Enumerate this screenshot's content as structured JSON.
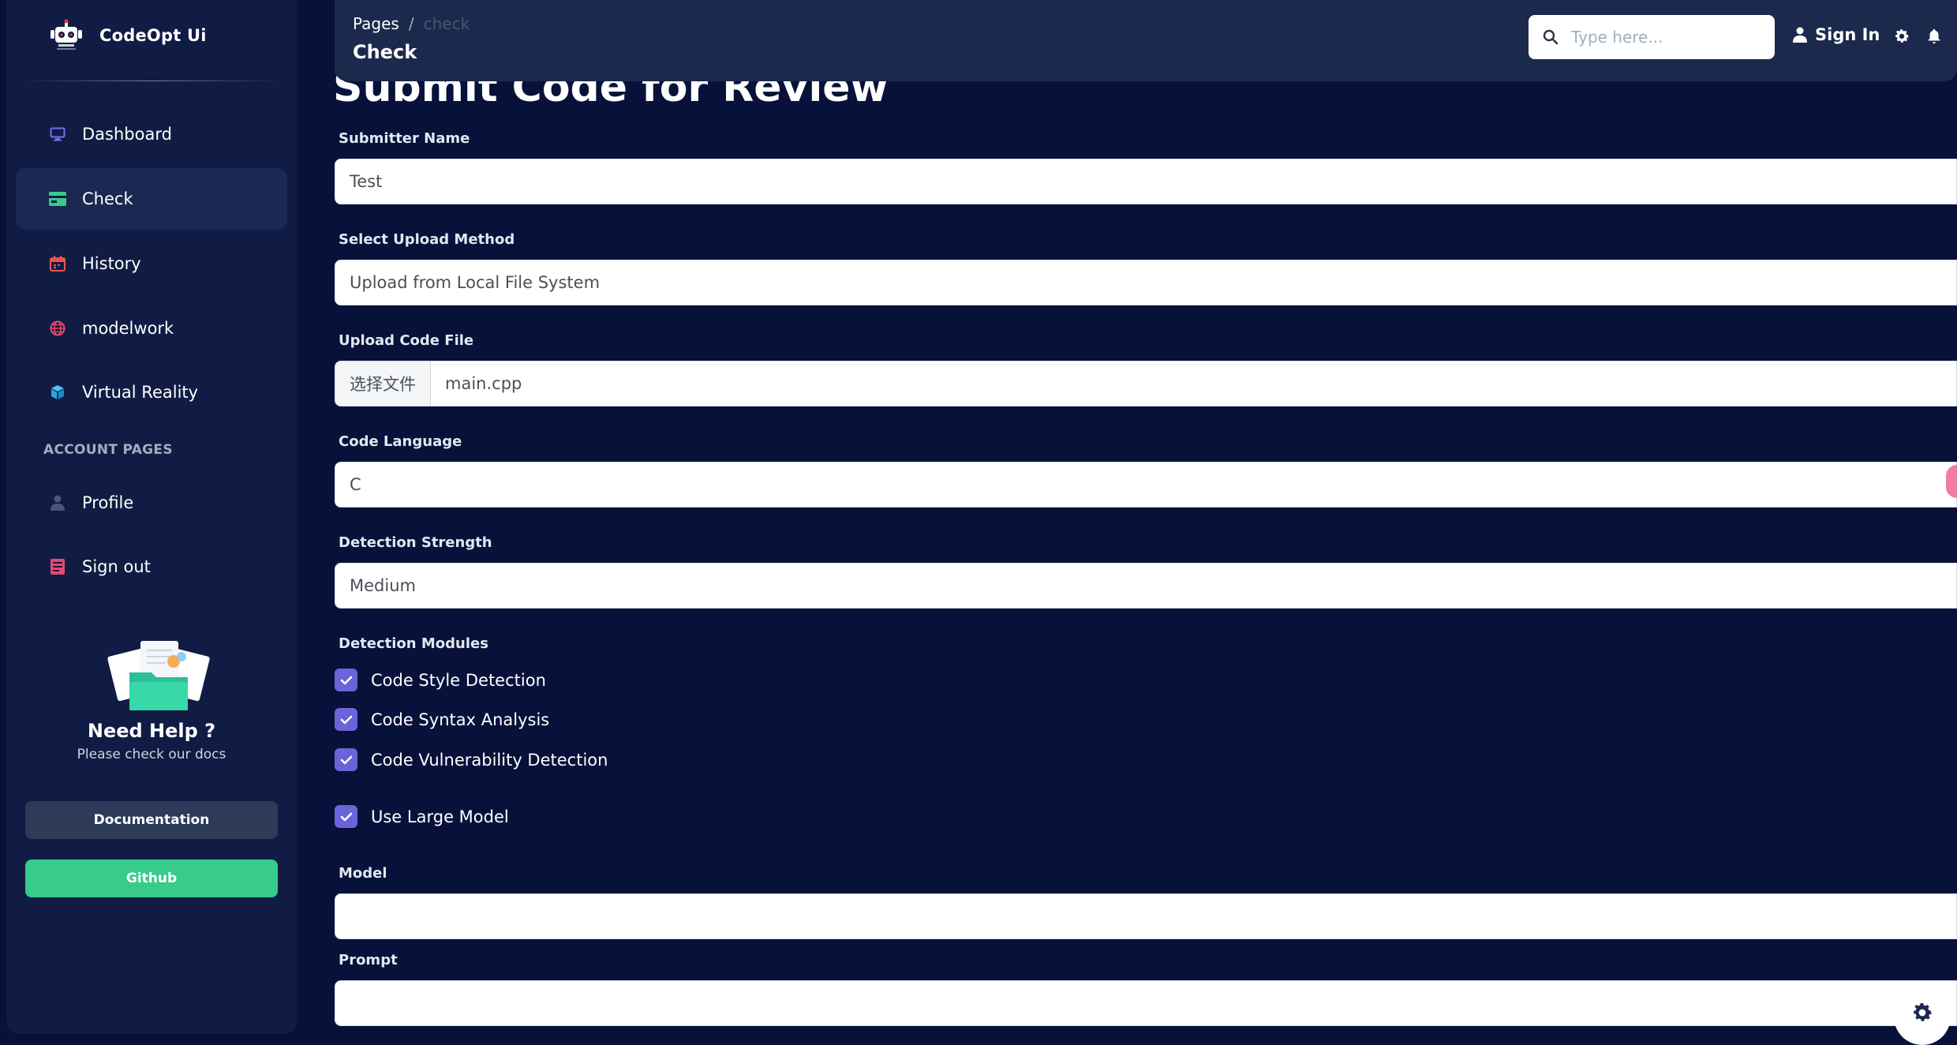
{
  "brand": {
    "name": "CodeOpt Ui"
  },
  "sidebar": {
    "items": [
      {
        "label": "Dashboard",
        "icon": "monitor-icon"
      },
      {
        "label": "Check",
        "icon": "card-icon"
      },
      {
        "label": "History",
        "icon": "calendar-icon"
      },
      {
        "label": "modelwork",
        "icon": "globe-icon"
      },
      {
        "label": "Virtual Reality",
        "icon": "cube-icon"
      }
    ],
    "section_title": "ACCOUNT PAGES",
    "account_items": [
      {
        "label": "Profile",
        "icon": "person-icon"
      },
      {
        "label": "Sign out",
        "icon": "document-icon"
      }
    ],
    "help": {
      "title": "Need Help ?",
      "subtitle": "Please check our docs",
      "docs_button": "Documentation",
      "github_button": "Github"
    }
  },
  "navbar": {
    "breadcrumb": {
      "root": "Pages",
      "separator": "/",
      "current": "check"
    },
    "title": "Check",
    "search_placeholder": "Type here...",
    "sign_in": "Sign In"
  },
  "form": {
    "heading": "Submit Code for Review",
    "submitter": {
      "label": "Submitter Name",
      "value": "Test"
    },
    "upload_method": {
      "label": "Select Upload Method",
      "value": "Upload from Local File System"
    },
    "upload_file": {
      "label": "Upload Code File",
      "button": "选择文件",
      "filename": "main.cpp"
    },
    "language": {
      "label": "Code Language",
      "value": "C"
    },
    "strength": {
      "label": "Detection Strength",
      "value": "Medium"
    },
    "modules": {
      "label": "Detection Modules",
      "items": [
        {
          "label": "Code Style Detection",
          "checked": true
        },
        {
          "label": "Code Syntax Analysis",
          "checked": true
        },
        {
          "label": "Code Vulnerability Detection",
          "checked": true
        }
      ]
    },
    "large_model": {
      "label": "Use Large Model",
      "checked": true
    },
    "model": {
      "label": "Model",
      "value": ""
    },
    "prompt": {
      "label": "Prompt",
      "value": ""
    }
  },
  "colors": {
    "background": "#07113a",
    "sidebar": "#111c44",
    "accent_green": "#38cb89",
    "checkbox": "#6b63d8"
  }
}
